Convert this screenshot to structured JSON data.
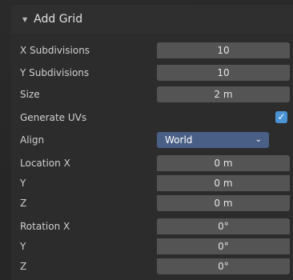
{
  "panel": {
    "title": "Add Grid",
    "collapse_glyph": "▼",
    "collapse_icon": "disclosure-triangle-down"
  },
  "fields": {
    "x_subdivisions": {
      "label": "X Subdivisions",
      "value": "10"
    },
    "y_subdivisions": {
      "label": "Y Subdivisions",
      "value": "10"
    },
    "size": {
      "label": "Size",
      "value": "2 m"
    },
    "generate_uvs": {
      "label": "Generate UVs",
      "checked": true,
      "glyph": "✓"
    },
    "align": {
      "label": "Align",
      "value": "World",
      "chevron": "⌄"
    },
    "location": {
      "x": {
        "label": "Location X",
        "value": "0 m"
      },
      "y": {
        "label": "Y",
        "value": "0 m"
      },
      "z": {
        "label": "Z",
        "value": "0 m"
      }
    },
    "rotation": {
      "x": {
        "label": "Rotation X",
        "value": "0°"
      },
      "y": {
        "label": "Y",
        "value": "0°"
      },
      "z": {
        "label": "Z",
        "value": "0°"
      }
    }
  },
  "colors": {
    "panel_bg": "#2c2c2c",
    "field_bg": "#545454",
    "dropdown_bg": "#4a5f85",
    "checkbox_bg": "#4a93d6"
  }
}
